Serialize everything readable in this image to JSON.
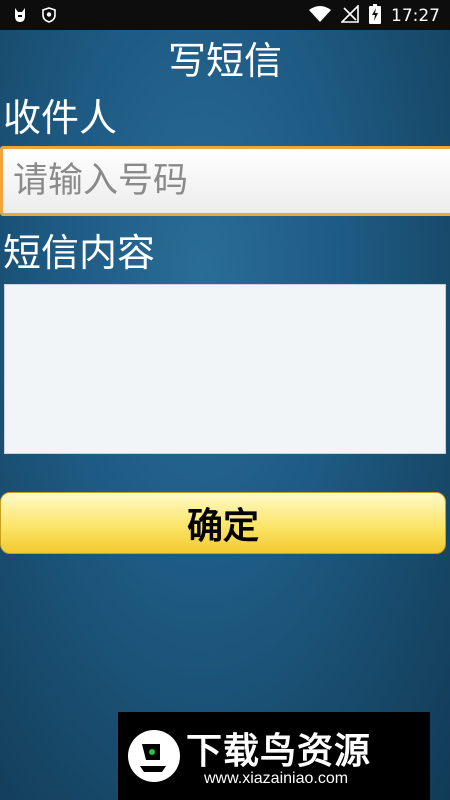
{
  "status_bar": {
    "time": "17:27",
    "icons": [
      "cat-icon",
      "shield-icon",
      "wifi-icon",
      "no-signal-icon",
      "battery-charging-icon"
    ]
  },
  "title": "写短信",
  "recipient": {
    "label": "收件人",
    "placeholder": "请输入号码",
    "value": ""
  },
  "message": {
    "label": "短信内容",
    "value": ""
  },
  "confirm_button": "确定",
  "watermark": {
    "brand": "下载鸟资源",
    "url": "www.xiazainiao.com"
  },
  "colors": {
    "background": "#1e5b84",
    "input_border": "#f2a33a",
    "button_yellow": "#fbe56a"
  }
}
